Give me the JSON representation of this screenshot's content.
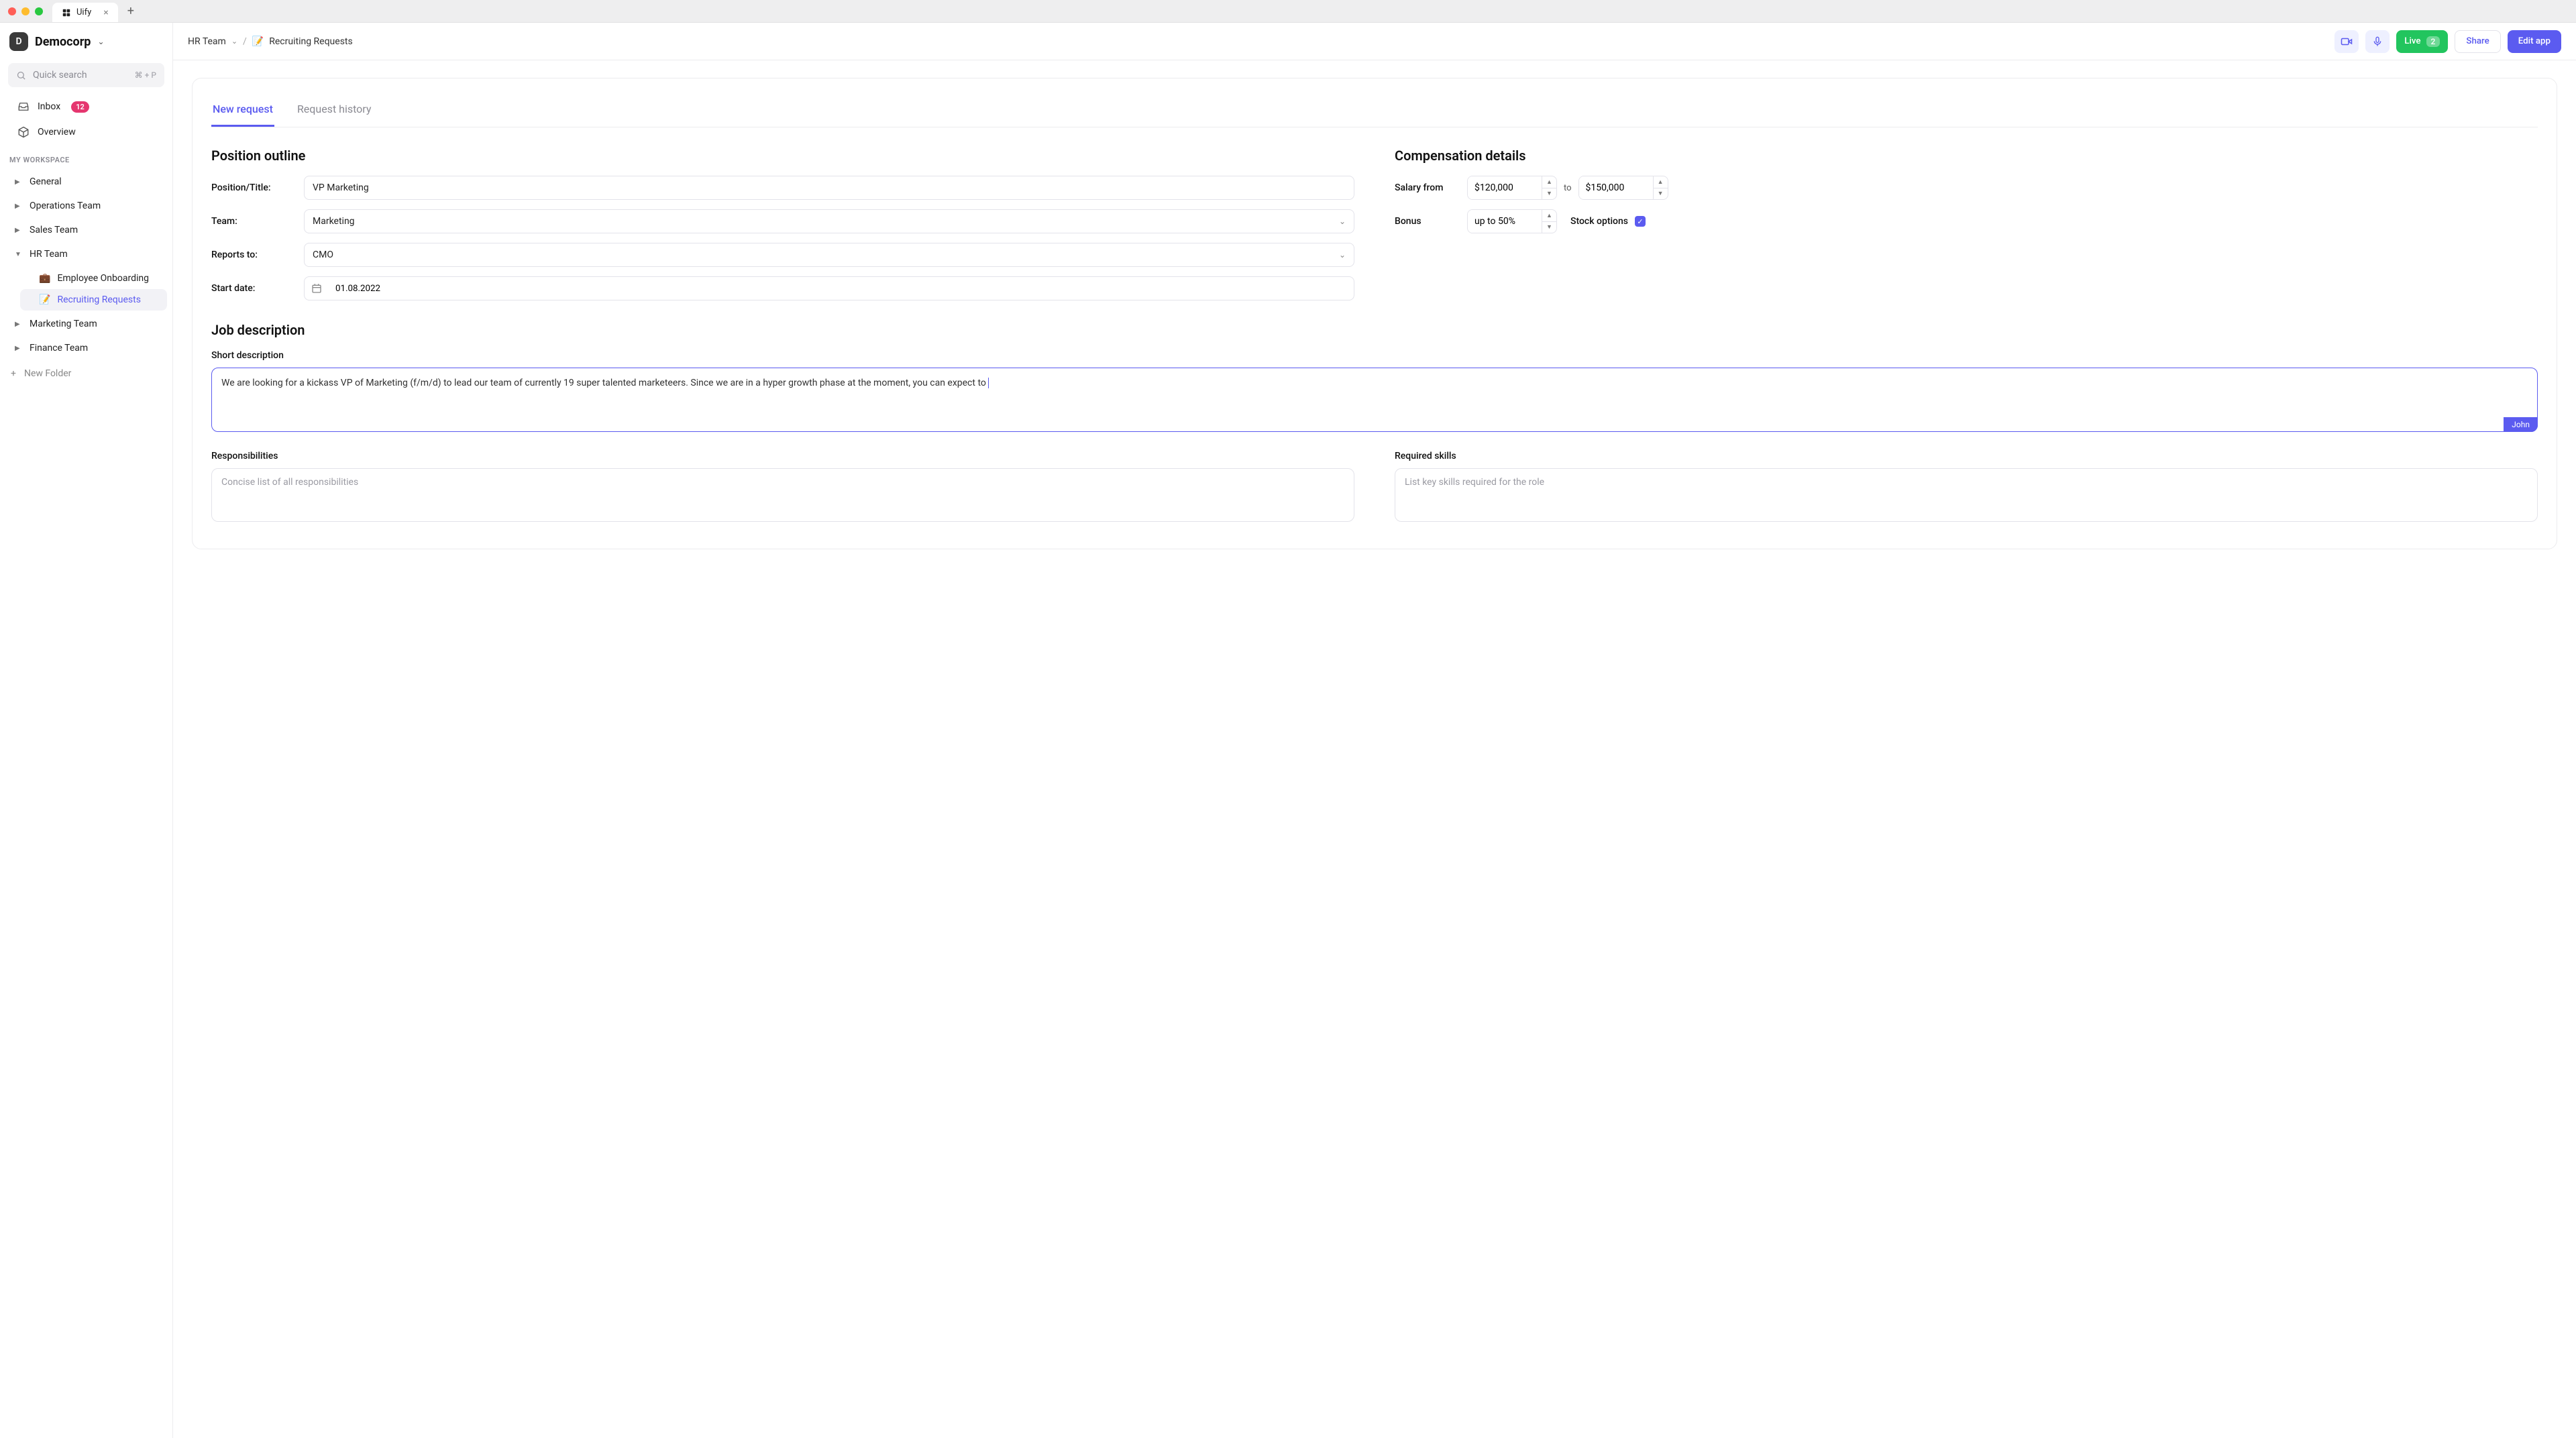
{
  "window": {
    "tab_title": "Uify"
  },
  "workspace": {
    "avatar_letter": "D",
    "name": "Democorp"
  },
  "search": {
    "placeholder": "Quick search",
    "shortcut": "⌘ + P"
  },
  "nav": {
    "inbox_label": "Inbox",
    "inbox_badge": "12",
    "overview_label": "Overview"
  },
  "section_label": "MY WORKSPACE",
  "tree": {
    "general": "General",
    "operations": "Operations Team",
    "sales": "Sales Team",
    "hr": "HR Team",
    "hr_children": {
      "onboarding_icon": "💼",
      "onboarding": "Employee Onboarding",
      "recruiting_icon": "📝",
      "recruiting": "Recruiting Requests"
    },
    "marketing": "Marketing Team",
    "finance": "Finance Team",
    "new_folder": "New Folder"
  },
  "breadcrumb": {
    "root": "HR Team",
    "page_icon": "📝",
    "page": "Recruiting Requests"
  },
  "topbar": {
    "live_label": "Live",
    "live_count": "2",
    "share": "Share",
    "edit": "Edit app"
  },
  "tabs": {
    "new_request": "New request",
    "history": "Request history"
  },
  "form": {
    "position_section": "Position outline",
    "compensation_section": "Compensation details",
    "position_label": "Position/Title:",
    "position_value": "VP Marketing",
    "team_label": "Team:",
    "team_value": "Marketing",
    "reports_label": "Reports to:",
    "reports_value": "CMO",
    "start_label": "Start date:",
    "start_value": "01.08.2022",
    "salary_label": "Salary from",
    "salary_from": "$120,000",
    "salary_to_word": "to",
    "salary_to": "$150,000",
    "bonus_label": "Bonus",
    "bonus_value": "up to 50%",
    "stock_label": "Stock options",
    "job_desc_section": "Job description",
    "short_desc_label": "Short description",
    "short_desc_value": "We are looking for a kickass VP of Marketing (f/m/d) to lead our team of currently 19 super talented marketeers. Since we are in a hyper growth phase at the moment, you can expect to ",
    "presence_name": "John",
    "responsibilities_label": "Responsibilities",
    "responsibilities_placeholder": "Concise list of all responsibilities",
    "skills_label": "Required skills",
    "skills_placeholder": "List key skills required for the role"
  }
}
